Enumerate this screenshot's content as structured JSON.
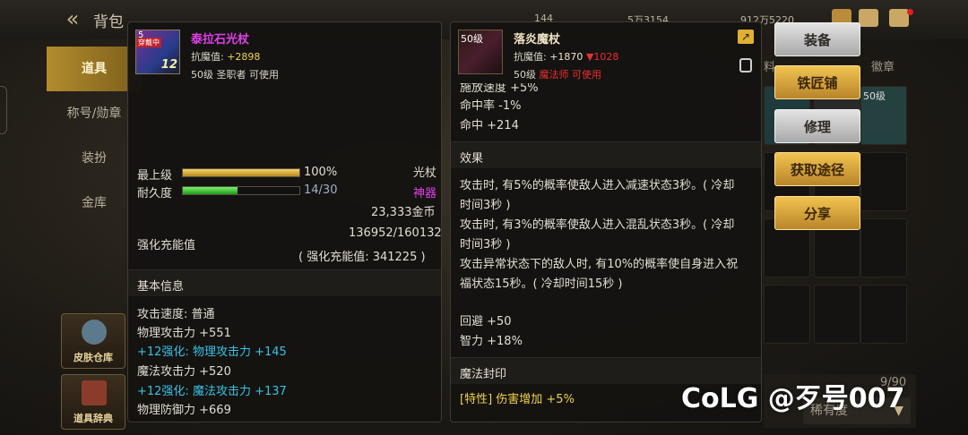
{
  "topbar": {
    "title": "背包",
    "res1": "144",
    "res2": "5万3154",
    "res3": "912万5220"
  },
  "sidebar": {
    "items": [
      {
        "label": "道具",
        "active": true
      },
      {
        "label": "称号/勋章",
        "active": false
      },
      {
        "label": "装扮",
        "active": false
      },
      {
        "label": "金库",
        "active": false
      }
    ],
    "card1": "皮肤仓库",
    "card2": "道具辞典"
  },
  "right_tabs": {
    "tab_partial": "料",
    "tab_emblem": "徽章",
    "cell_level": "50级"
  },
  "inventory": {
    "count": "9/90",
    "sort_label": "稀有度"
  },
  "left_item": {
    "badge_level": "5",
    "badge_reinforce": "12",
    "badge_tag": "穿戴中",
    "name": "泰拉石光杖",
    "anti_magic_label": "抗魔值:",
    "anti_magic_value": "+2898",
    "level_info": "50级 圣职者 可使用",
    "max_level_label": "最上级",
    "max_level_value": "100%",
    "max_level_fill": 1.0,
    "weapon_type": "光杖",
    "durability_label": "耐久度",
    "durability_value": "14/30",
    "durability_fill": 0.4667,
    "rarity": "神器",
    "price": "23,333金币",
    "charge_label": "强化充能值",
    "charge_value": "136952/160132",
    "charge_sub": "( 强化充能值: 341225 )",
    "basic_info_title": "基本信息",
    "stats": [
      {
        "text": "攻击速度: 普通",
        "color": "white"
      },
      {
        "text": "物理攻击力 +551",
        "color": "white"
      },
      {
        "text": "+12强化: 物理攻击力 +145",
        "color": "cyan"
      },
      {
        "text": "魔法攻击力 +520",
        "color": "white"
      },
      {
        "text": "+12强化: 魔法攻击力 +137",
        "color": "cyan"
      },
      {
        "text": "物理防御力 +669",
        "color": "white"
      }
    ]
  },
  "right_item": {
    "level_tag": "50级",
    "name": "落炎魔杖",
    "anti_magic_label": "抗魔值:",
    "anti_magic_value": "+1870",
    "anti_magic_diff": "▼1028",
    "level_info_prefix": "50级",
    "level_info_class": "魔法师 可使用",
    "cut_line": "施放速度 +5%",
    "hit_rate": "命中率 -1%",
    "hit": "命中 +214",
    "effect_title": "效果",
    "effect_lines": [
      "攻击时, 有5%的概率使敌人进入减速状态3秒。( 冷却",
      "时间3秒 )",
      "攻击时, 有3%的概率使敌人进入混乱状态3秒。( 冷却",
      "时间3秒 )",
      "攻击异常状态下的敌人时, 有10%的概率使自身进入祝",
      "福状态15秒。( 冷却时间15秒 )"
    ],
    "evade": "回避 +50",
    "intelligence": "智力 +18%",
    "seal_title": "魔法封印",
    "seal_line": "[特性] 伤害增加 +5%"
  },
  "buttons": {
    "equip": "装备",
    "smith": "铁匠铺",
    "repair": "修理",
    "source": "获取途径",
    "share": "分享"
  },
  "watermark": "CoLG @歹号007",
  "colors": {
    "gold_button": "#d9a23c",
    "grey_button": "#c8c8c8",
    "magenta_name": "#e040e8",
    "cyan_bonus": "#38c2e6",
    "red_text": "#e83030",
    "yellow_seal": "#f0d24c"
  }
}
